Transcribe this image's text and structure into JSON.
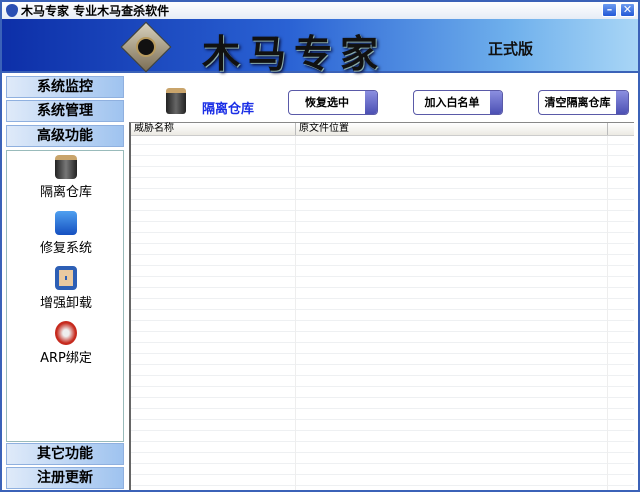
{
  "window": {
    "title": "木马专家  专业木马查杀软件",
    "minimize": "–",
    "close": "✕"
  },
  "banner": {
    "brand": "木马专家",
    "edition": "正式版"
  },
  "sidebar": {
    "top": [
      {
        "label": "系统监控"
      },
      {
        "label": "系统管理"
      },
      {
        "label": "高级功能"
      }
    ],
    "tools": [
      {
        "label": "隔离仓库",
        "icon": "quarantine-bin-icon"
      },
      {
        "label": "修复系统",
        "icon": "repair-monitor-icon"
      },
      {
        "label": "增强卸载",
        "icon": "uninstall-icon"
      },
      {
        "label": "ARP绑定",
        "icon": "arp-icon"
      }
    ],
    "bottom": [
      {
        "label": "其它功能"
      },
      {
        "label": "注册更新"
      }
    ]
  },
  "main": {
    "title": "隔离仓库",
    "buttons": [
      {
        "label": "恢复选中"
      },
      {
        "label": "加入白名单"
      },
      {
        "label": "清空隔离仓库"
      }
    ],
    "table": {
      "columns": [
        "威胁名称",
        "原文件位置",
        ""
      ],
      "rows": []
    }
  }
}
